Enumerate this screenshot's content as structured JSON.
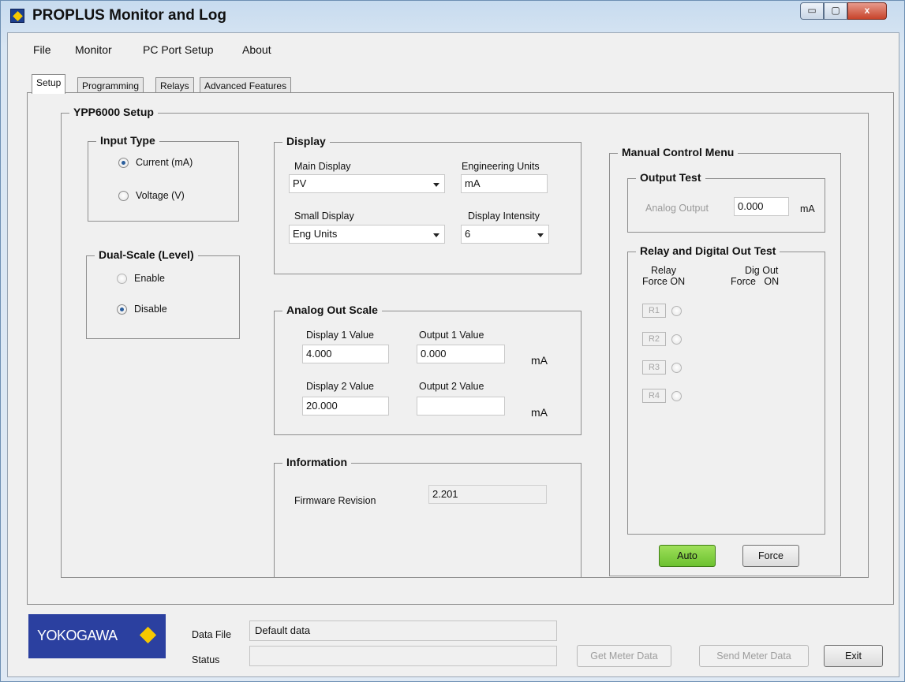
{
  "window": {
    "title": "PROPLUS Monitor and Log",
    "controls": {
      "minimize": "▭",
      "maximize": "▢",
      "close": "x"
    }
  },
  "menu": [
    "File",
    "Monitor",
    "PC Port Setup",
    "About"
  ],
  "tabs": [
    {
      "label": "Setup",
      "active": true
    },
    {
      "label": "Programming",
      "active": false
    },
    {
      "label": "Relays",
      "active": false
    },
    {
      "label": "Advanced Features",
      "active": false
    }
  ],
  "setup": {
    "title": "YPP6000 Setup",
    "input_type": {
      "title": "Input Type",
      "options": [
        {
          "label": "Current (mA)",
          "checked": true
        },
        {
          "label": "Voltage (V)",
          "checked": false
        }
      ]
    },
    "dual_scale": {
      "title": "Dual-Scale (Level)",
      "options": [
        {
          "label": "Enable",
          "checked": false
        },
        {
          "label": "Disable",
          "checked": true
        }
      ]
    },
    "display": {
      "title": "Display",
      "main_display_label": "Main Display",
      "main_display_value": "PV",
      "engineering_units_label": "Engineering Units",
      "engineering_units_value": "mA",
      "small_display_label": "Small Display",
      "small_display_value": "Eng Units",
      "display_intensity_label": "Display Intensity",
      "display_intensity_value": "6"
    },
    "analog_out_scale": {
      "title": "Analog Out Scale",
      "display1_label": "Display 1 Value",
      "display1_value": "4.000",
      "output1_label": "Output 1 Value",
      "output1_value": "0.000",
      "display2_label": "Display 2 Value",
      "display2_value": "20.000",
      "output2_label": "Output 2 Value",
      "output2_value": "",
      "unit1": "mA",
      "unit2": "mA"
    },
    "information": {
      "title": "Information",
      "firmware_label": "Firmware Revision",
      "firmware_value": "2.201"
    },
    "manual_control": {
      "title": "Manual Control Menu",
      "output_test": {
        "title": "Output Test",
        "analog_output_label": "Analog Output",
        "analog_output_value": "0.000",
        "unit": "mA"
      },
      "relay_test": {
        "title": "Relay and Digital Out Test",
        "relay_header": "Relay",
        "relay_subheader": "Force  ON",
        "digout_header": "Dig Out",
        "digout_subheader": "Force   ON",
        "relays": [
          "R1",
          "R2",
          "R3",
          "R4"
        ]
      },
      "auto_label": "Auto",
      "force_label": "Force"
    }
  },
  "footer": {
    "logo_text": "YOKOGAWA",
    "data_file_label": "Data File",
    "data_file_value": "Default data",
    "status_label": "Status",
    "status_value": "",
    "get_meter_data_label": "Get Meter Data",
    "send_meter_data_label": "Send Meter Data",
    "exit_label": "Exit"
  },
  "colors": {
    "auto_button": "#7ccf3c",
    "logo_background": "#2b40a0",
    "logo_diamond": "#f6c800"
  }
}
